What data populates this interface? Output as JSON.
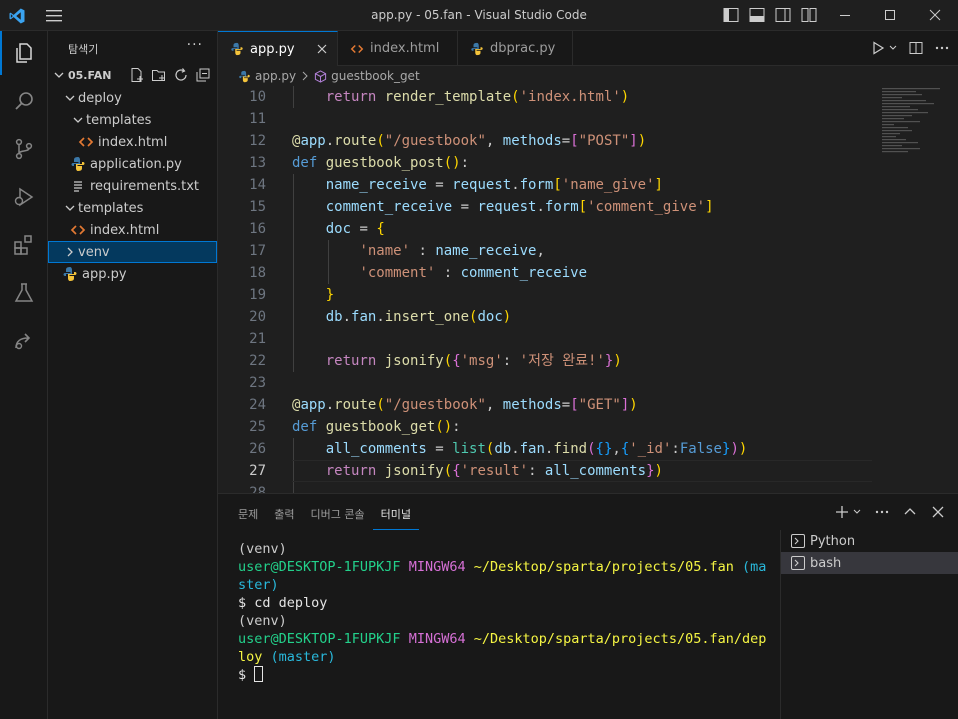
{
  "window": {
    "title": "app.py - 05.fan - Visual Studio Code"
  },
  "sidebar": {
    "title": "탐색기",
    "more": "···",
    "root": "05.FAN",
    "items": [
      {
        "label": "deploy",
        "kind": "folder-open"
      },
      {
        "label": "templates",
        "kind": "folder-open"
      },
      {
        "label": "index.html",
        "kind": "html"
      },
      {
        "label": "application.py",
        "kind": "python"
      },
      {
        "label": "requirements.txt",
        "kind": "text"
      },
      {
        "label": "templates",
        "kind": "folder-open"
      },
      {
        "label": "index.html",
        "kind": "html"
      },
      {
        "label": "venv",
        "kind": "folder-closed",
        "selected": true
      },
      {
        "label": "app.py",
        "kind": "python"
      }
    ]
  },
  "tabs": [
    {
      "label": "app.py",
      "kind": "python",
      "active": true
    },
    {
      "label": "index.html",
      "kind": "html"
    },
    {
      "label": "dbprac.py",
      "kind": "python"
    }
  ],
  "breadcrumb": {
    "file": "app.py",
    "symbol": "guestbook_get"
  },
  "editor": {
    "current_line": 27,
    "line_numbers": [
      "10",
      "11",
      "12",
      "13",
      "14",
      "15",
      "16",
      "17",
      "18",
      "19",
      "20",
      "21",
      "22",
      "23",
      "24",
      "25",
      "26",
      "27",
      "28"
    ]
  },
  "panel": {
    "tabs": [
      "문제",
      "출력",
      "디버그 콘솔",
      "터미널"
    ],
    "active_tab": "터미널",
    "terminal_lines": {
      "l1": "(venv)",
      "l2_user": "user@DESKTOP-1FUPKJF",
      "l2_env": "MINGW64",
      "l2_path": "~/Desktop/sparta/projects/05.fan",
      "l2_branch_a": "(ma",
      "l3_branch_b": "ster)",
      "l4": "$ cd deploy",
      "l5": "(venv)",
      "l6_user": "user@DESKTOP-1FUPKJF",
      "l6_env": "MINGW64",
      "l6_path": "~/Desktop/sparta/projects/05.fan/dep",
      "l7_path": "loy",
      "l7_branch": "(master)",
      "l8": "$"
    },
    "terminals": [
      {
        "label": "Python"
      },
      {
        "label": "bash",
        "active": true
      }
    ]
  },
  "colors": {
    "accent": "#0078d4",
    "background": "#1f1f1f",
    "sidebar": "#181818"
  }
}
